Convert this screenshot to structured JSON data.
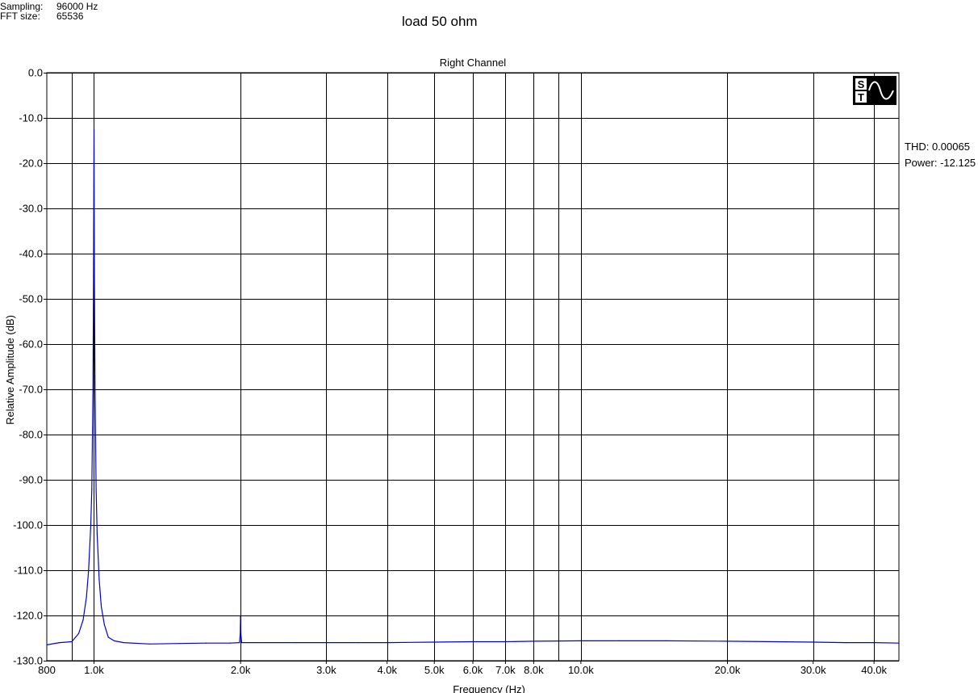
{
  "header": {
    "sampling_label": "Sampling:",
    "sampling_value": "96000 Hz",
    "fft_label": "FFT size:",
    "fft_value": "65536",
    "annotation": "load 50 ohm"
  },
  "stats": {
    "thd": "THD: 0.00065",
    "power": "Power: -12.125"
  },
  "logo_text": "ST",
  "colors": {
    "trace": "#0000dd",
    "grid": "#000000",
    "background": "#ffffff"
  },
  "chart_data": {
    "type": "line",
    "title": "Right Channel",
    "xlabel": "Frequency (Hz)",
    "ylabel": "Relative Amplitude (dB)",
    "x_scale": "log",
    "xlim": [
      800,
      45000
    ],
    "ylim": [
      -130,
      0
    ],
    "grid": true,
    "x_ticks": [
      {
        "value": 1000,
        "label": "1.0k"
      },
      {
        "value": 2000,
        "label": "2.0k"
      },
      {
        "value": 3000,
        "label": "3.0k"
      },
      {
        "value": 4000,
        "label": "4.0k"
      },
      {
        "value": 5000,
        "label": "5.0k"
      },
      {
        "value": 6000,
        "label": "6.0k"
      },
      {
        "value": 7000,
        "label": "7.0k"
      },
      {
        "value": 8000,
        "label": "8.0k"
      },
      {
        "value": 10000,
        "label": "10.0k"
      },
      {
        "value": 20000,
        "label": "20.0k"
      },
      {
        "value": 30000,
        "label": "30.0k"
      },
      {
        "value": 40000,
        "label": "40.0k"
      }
    ],
    "x_minor_gridlines": [
      900,
      9000
    ],
    "y_ticks": [
      {
        "value": 0,
        "label": "0.0"
      },
      {
        "value": -10,
        "label": "-10.0"
      },
      {
        "value": -20,
        "label": "-20.0"
      },
      {
        "value": -30,
        "label": "-30.0"
      },
      {
        "value": -40,
        "label": "-40.0"
      },
      {
        "value": -50,
        "label": "-50.0"
      },
      {
        "value": -60,
        "label": "-60.0"
      },
      {
        "value": -70,
        "label": "-70.0"
      },
      {
        "value": -80,
        "label": "-80.0"
      },
      {
        "value": -90,
        "label": "-90.0"
      },
      {
        "value": -100,
        "label": "-100.0"
      },
      {
        "value": -110,
        "label": "-110.0"
      },
      {
        "value": -120,
        "label": "-120.0"
      },
      {
        "value": -130,
        "label": "-130.0"
      }
    ],
    "x_min_label": "800",
    "series": [
      {
        "x": [
          800,
          850,
          900,
          930,
          950,
          965,
          975,
          985,
          990,
          995,
          998,
          1000,
          1002,
          1005,
          1010,
          1015,
          1025,
          1035,
          1050,
          1070,
          1100,
          1150,
          1300,
          1500,
          1700,
          1900,
          1990,
          1997,
          2000,
          2003,
          2010,
          2200,
          2600,
          3000,
          3500,
          4000,
          5000,
          6000,
          7000,
          8000,
          10000,
          12000,
          15000,
          20000,
          25000,
          30000,
          35000,
          40000,
          45000
        ],
        "y": [
          -126.5,
          -126,
          -125.8,
          -124,
          -121,
          -116,
          -110,
          -100,
          -92,
          -70,
          -45,
          -12.5,
          -45,
          -70,
          -92,
          -102,
          -112,
          -118,
          -122,
          -124.8,
          -125.6,
          -126,
          -126.3,
          -126.2,
          -126.1,
          -126.1,
          -126,
          -124,
          -120.2,
          -124,
          -126,
          -126,
          -126,
          -126,
          -126,
          -126,
          -125.9,
          -125.8,
          -125.8,
          -125.7,
          -125.6,
          -125.6,
          -125.6,
          -125.7,
          -125.8,
          -125.9,
          -126,
          -126,
          -126.1
        ]
      }
    ]
  }
}
